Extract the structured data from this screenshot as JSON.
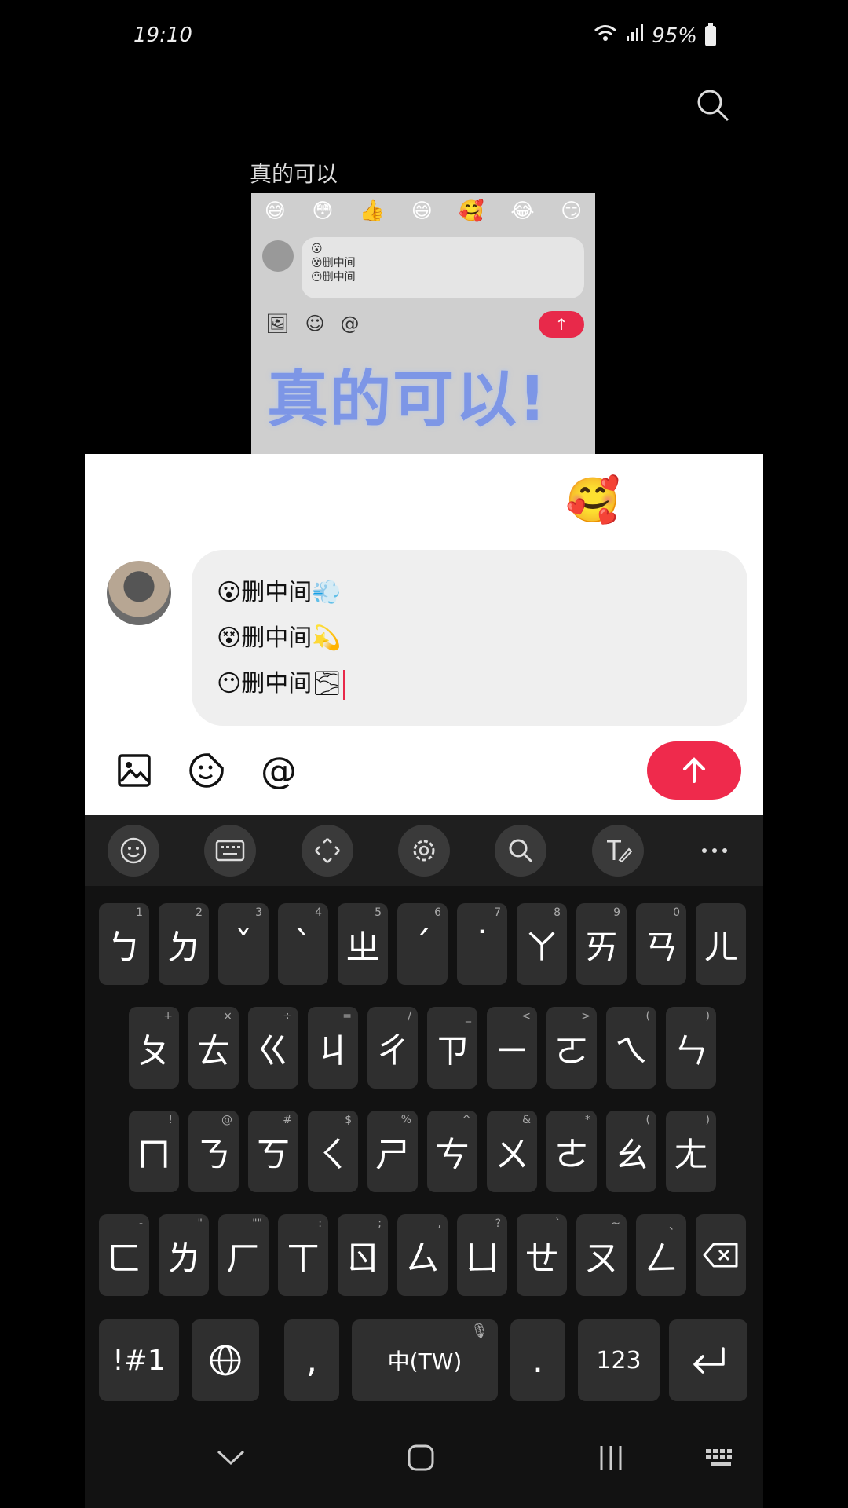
{
  "status": {
    "time": "19:10",
    "battery": "95%"
  },
  "video": {
    "caption": "真的可以",
    "overlay_text": "真的可以!",
    "emojis": [
      "😅",
      "😳",
      "👍",
      "😄",
      "🥰",
      "😂",
      "😏"
    ],
    "bubble_lines": [
      "😮",
      "😵删中间",
      "😶删中间"
    ]
  },
  "emoji_bar": [
    "😂",
    "😆",
    "😘",
    "😁",
    "🥰",
    "😳"
  ],
  "compose": {
    "lines": [
      {
        "emoji": "😮",
        "text": "删中间",
        "tail": "💨"
      },
      {
        "emoji": "😵",
        "text": "删中间",
        "tail": "💫"
      },
      {
        "emoji": "😶",
        "text": "删中间",
        "tail": "🌫"
      }
    ]
  },
  "keyboard": {
    "row1": [
      {
        "label": "ㄅ",
        "hint": "1"
      },
      {
        "label": "ㄉ",
        "hint": "2"
      },
      {
        "label": "ˇ",
        "hint": "3"
      },
      {
        "label": "ˋ",
        "hint": "4"
      },
      {
        "label": "ㄓ",
        "hint": "5"
      },
      {
        "label": "ˊ",
        "hint": "6"
      },
      {
        "label": "˙",
        "hint": "7"
      },
      {
        "label": "ㄚ",
        "hint": "8"
      },
      {
        "label": "ㄞ",
        "hint": "9"
      },
      {
        "label": "ㄢ",
        "hint": "0"
      },
      {
        "label": "ㄦ",
        "hint": ""
      }
    ],
    "row2": [
      {
        "label": "ㄆ",
        "hint": "+"
      },
      {
        "label": "ㄊ",
        "hint": "×"
      },
      {
        "label": "ㄍ",
        "hint": "÷"
      },
      {
        "label": "ㄐ",
        "hint": "="
      },
      {
        "label": "ㄔ",
        "hint": "/"
      },
      {
        "label": "ㄗ",
        "hint": "_"
      },
      {
        "label": "ㄧ",
        "hint": "<"
      },
      {
        "label": "ㄛ",
        "hint": ">"
      },
      {
        "label": "ㄟ",
        "hint": "("
      },
      {
        "label": "ㄣ",
        "hint": ")"
      }
    ],
    "row3": [
      {
        "label": "ㄇ",
        "hint": "!"
      },
      {
        "label": "ㄋ",
        "hint": "@"
      },
      {
        "label": "ㄎ",
        "hint": "#"
      },
      {
        "label": "ㄑ",
        "hint": "$"
      },
      {
        "label": "ㄕ",
        "hint": "%"
      },
      {
        "label": "ㄘ",
        "hint": "^"
      },
      {
        "label": "ㄨ",
        "hint": "&"
      },
      {
        "label": "ㄜ",
        "hint": "*"
      },
      {
        "label": "ㄠ",
        "hint": "("
      },
      {
        "label": "ㄤ",
        "hint": ")"
      }
    ],
    "row4": [
      {
        "label": "ㄈ",
        "hint": "-"
      },
      {
        "label": "ㄌ",
        "hint": "\""
      },
      {
        "label": "ㄏ",
        "hint": "\"\""
      },
      {
        "label": "ㄒ",
        "hint": ":"
      },
      {
        "label": "ㄖ",
        "hint": ";"
      },
      {
        "label": "ㄙ",
        "hint": ","
      },
      {
        "label": "ㄩ",
        "hint": "?"
      },
      {
        "label": "ㄝ",
        "hint": "`"
      },
      {
        "label": "ㄡ",
        "hint": "~"
      },
      {
        "label": "ㄥ",
        "hint": "、"
      }
    ],
    "symbols_label": "!#1",
    "comma": ",",
    "space_label": "中(TW)",
    "period": ".",
    "numbers_label": "123"
  }
}
